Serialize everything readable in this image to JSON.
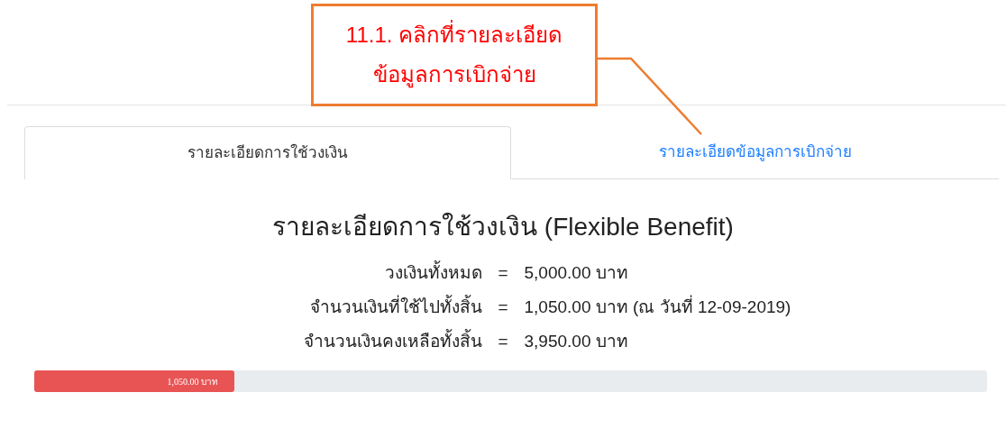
{
  "callout": {
    "lines": [
      "11.1. คลิกที่รายละเอียด",
      "ข้อมูลการเบิกจ่าย"
    ]
  },
  "tabs": [
    {
      "label": "รายละเอียดการใช้วงเงิน",
      "selected": true
    },
    {
      "label": "รายละเอียดข้อมูลการเบิกจ่าย",
      "selected": false
    }
  ],
  "heading": "รายละเอียดการใช้วงเงิน (Flexible Benefit)",
  "summary": [
    {
      "label": "วงเงินทั้งหมด",
      "separator": "=",
      "value": "5,000.00 บาท"
    },
    {
      "label": "จำนวนเงินที่ใช้ไปทั้งสิ้น",
      "separator": "=",
      "value": "1,050.00 บาท (ณ วันที่ 12-09-2019)"
    },
    {
      "label": "จำนวนเงินคงเหลือทั้งสิ้น",
      "separator": "=",
      "value": "3,950.00 บาท"
    }
  ],
  "usage_bar": {
    "level": 0.21,
    "label": "1,050.00 บาท"
  }
}
